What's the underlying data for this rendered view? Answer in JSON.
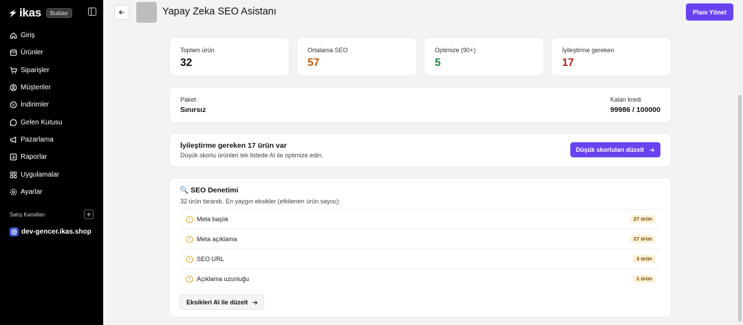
{
  "sidebar": {
    "brand": "ikas",
    "badge": "Builder",
    "items": [
      {
        "label": "Giriş",
        "icon": "home-icon"
      },
      {
        "label": "Ürünler",
        "icon": "box-icon"
      },
      {
        "label": "Siparişler",
        "icon": "cart-icon"
      },
      {
        "label": "Müşteriler",
        "icon": "users-icon"
      },
      {
        "label": "İndirimler",
        "icon": "discount-icon"
      },
      {
        "label": "Gelen Kutusu",
        "icon": "chat-icon"
      },
      {
        "label": "Pazarlama",
        "icon": "megaphone-icon"
      },
      {
        "label": "Raporlar",
        "icon": "chart-icon"
      },
      {
        "label": "Uygulamalar",
        "icon": "grid-icon"
      },
      {
        "label": "Ayarlar",
        "icon": "gear-icon"
      }
    ],
    "channels_label": "Satış Kanalları",
    "add_symbol": "+",
    "shop": "dev-gencer.ikas.shop"
  },
  "header": {
    "title": "Yapay Zeka SEO Asistanı",
    "plan_button": "Planı Yönet"
  },
  "stats": [
    {
      "label": "Toplam ürün",
      "value": "32",
      "color": "#111111"
    },
    {
      "label": "Ortalama SEO",
      "value": "57",
      "color": "#c2590a"
    },
    {
      "label": "Optimize (90+)",
      "value": "5",
      "color": "#1f8a3b"
    },
    {
      "label": "İyileştirme gereken",
      "value": "17",
      "color": "#b42318"
    }
  ],
  "package": {
    "label": "Paket",
    "value": "Sınırsız",
    "credit_label": "Kalan kredi",
    "credit_value": "99986 / 100000"
  },
  "improve": {
    "title": "İyileştirme gereken 17 ürün var",
    "subtitle": "Düşük skorlu ürünleri tek listede AI ile optimize edin.",
    "button": "Düşük skorluları düzelt"
  },
  "audit": {
    "title": "🔍 SEO Denetimi",
    "subtitle": "32 ürün tarandı. En yaygın eksikler (etkilenen ürün sayısı):",
    "issues": [
      {
        "label": "Meta başlık",
        "count": "27 ürün"
      },
      {
        "label": "Meta açıklama",
        "count": "27 ürün"
      },
      {
        "label": "SEO URL",
        "count": "3 ürün"
      },
      {
        "label": "Açıklama uzunluğu",
        "count": "1 ürün"
      }
    ],
    "fix_button": "Eksikleri AI ile düzelt"
  },
  "colors": {
    "accent": "#6a43f0",
    "sidebar_bg": "#000000",
    "warning": "#e0a21a"
  }
}
